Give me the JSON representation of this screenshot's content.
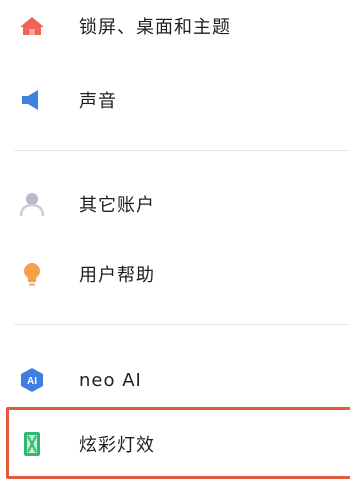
{
  "settings": {
    "items": [
      {
        "label": "锁屏、桌面和主题",
        "icon": "home-icon",
        "color": "#f06457"
      },
      {
        "label": "声音",
        "icon": "speaker-icon",
        "color": "#3d82e0"
      },
      {
        "label": "其它账户",
        "icon": "user-icon",
        "color": "#b8bcc6"
      },
      {
        "label": "用户帮助",
        "icon": "lightbulb-icon",
        "color": "#f5a04b"
      },
      {
        "label": "neo AI",
        "icon": "ai-icon",
        "color": "#3f7de0",
        "badge": "AI"
      },
      {
        "label": "炫彩灯效",
        "icon": "light-effect-icon",
        "color": "#2fb873"
      }
    ]
  },
  "highlight": {
    "color": "#e25b3c"
  }
}
